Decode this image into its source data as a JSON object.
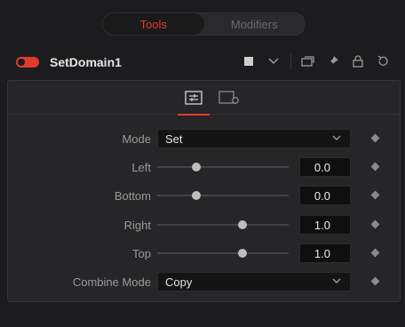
{
  "top_tabs": {
    "tools": "Tools",
    "modifiers": "Modifiers"
  },
  "tool": {
    "name": "SetDomain1",
    "enabled": true
  },
  "header_icons": [
    "color-square-icon",
    "chevron-down-icon",
    "version-icon",
    "pin-icon",
    "lock-icon",
    "reset-icon"
  ],
  "panel_tabs": [
    "controls-tab-icon",
    "settings-tab-icon"
  ],
  "fields": {
    "mode": {
      "label": "Mode",
      "value": "Set"
    },
    "left": {
      "label": "Left",
      "value": "0.0",
      "slider": 0.3
    },
    "bottom": {
      "label": "Bottom",
      "value": "0.0",
      "slider": 0.3
    },
    "right": {
      "label": "Right",
      "value": "1.0",
      "slider": 0.65
    },
    "top": {
      "label": "Top",
      "value": "1.0",
      "slider": 0.65
    },
    "combine_mode": {
      "label": "Combine Mode",
      "value": "Copy"
    }
  },
  "colors": {
    "accent": "#e23a2f",
    "background": "#1c1c1e",
    "panel": "#262628"
  }
}
